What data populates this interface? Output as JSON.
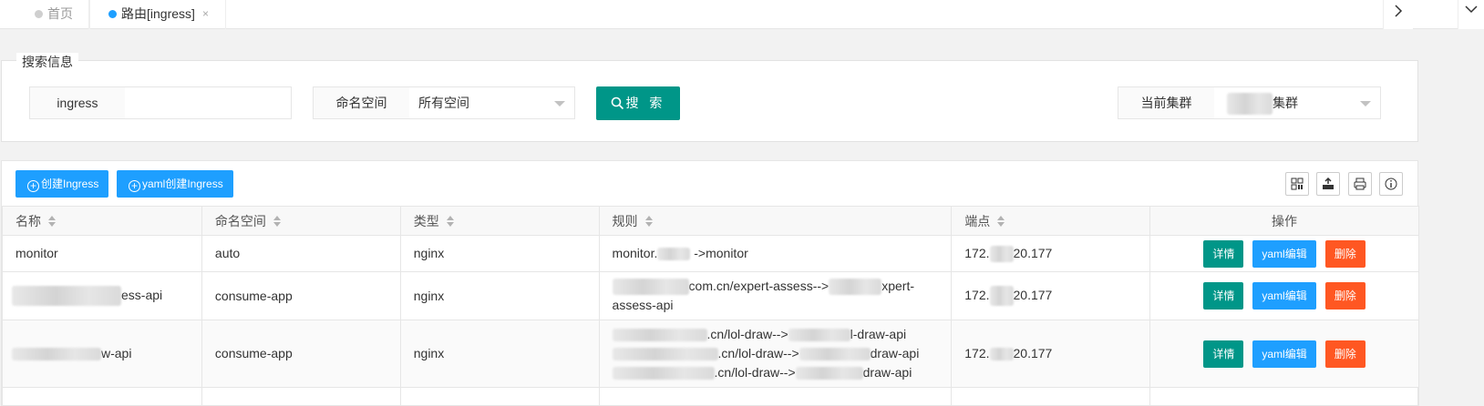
{
  "tabs": {
    "home": "首页",
    "current": "路由[ingress]",
    "close": "×",
    "next": "›"
  },
  "search": {
    "legend": "搜索信息",
    "name_label": "ingress",
    "name_value": "",
    "namespace_label": "命名空间",
    "namespace_value": "所有空间",
    "search_button": "搜 索",
    "cluster_label": "当前集群",
    "cluster_value_suffix": "集群"
  },
  "toolbar": {
    "create_ingress": "创建Ingress",
    "yaml_create_ingress": "yaml创建Ingress"
  },
  "table": {
    "headers": [
      "名称",
      "命名空间",
      "类型",
      "规则",
      "端点",
      "操作"
    ],
    "actions": {
      "detail": "详情",
      "yaml": "yaml编辑",
      "delete": "删除"
    },
    "rows": [
      {
        "name_prefix": "monitor",
        "namespace": "auto",
        "type": "nginx",
        "rule_lines": [
          {
            "a": "monitor.",
            "b": "->monitor",
            "c": ""
          }
        ],
        "endpoint_a": "172.",
        "endpoint_b": "20.177"
      },
      {
        "name_prefix": "",
        "name_suffix": "ess-api",
        "namespace": "consume-app",
        "type": "nginx",
        "rule_lines": [
          {
            "a": "",
            "b": "com.cn/expert-assess-->",
            "c": "xpert-"
          },
          {
            "a": "assess-api",
            "b": "",
            "c": ""
          }
        ],
        "endpoint_a": "172.",
        "endpoint_b": "20.177"
      },
      {
        "name_prefix": "",
        "name_suffix": "w-api",
        "namespace": "consume-app",
        "type": "nginx",
        "rule_lines": [
          {
            "a": "",
            "b": ".cn/lol-draw-->",
            "c": "l-draw-api"
          },
          {
            "a": "",
            "b": ".cn/lol-draw-->",
            "c": "draw-api"
          },
          {
            "a": "",
            "b": ".cn/lol-draw-->",
            "c": "draw-api"
          }
        ],
        "endpoint_a": "172.",
        "endpoint_b": "20.177"
      }
    ]
  },
  "colors": {
    "teal": "#009688",
    "blue": "#1e9fff",
    "orange": "#ff5722"
  }
}
